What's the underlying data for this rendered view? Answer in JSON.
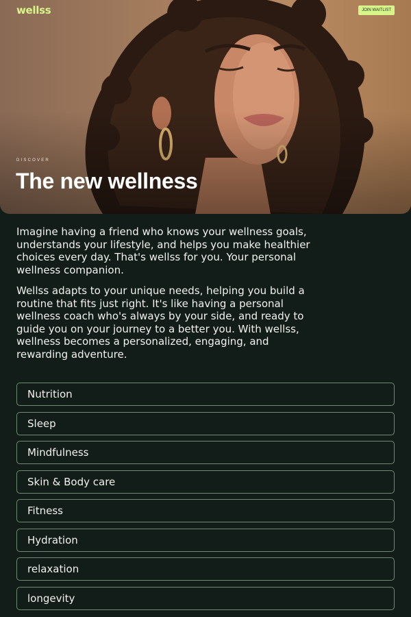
{
  "header": {
    "logo": "wellss",
    "cta_label": "JOIN WAITLIST"
  },
  "hero": {
    "eyebrow": "DISCOVER",
    "title": "The new wellness",
    "image_alt": "woman with curly hair and closed eyes"
  },
  "intro": {
    "paragraphs": [
      "Imagine having a friend who knows your wellness goals, understands your lifestyle, and helps you make healthier choices every day. That's wellss for you. Your personal wellness companion.",
      "Wellss adapts to your unique needs, helping you build a routine that fits just right. It's like having a personal wellness coach who's always by your side, and ready to guide you on your journey to a better you. With wellss, wellness becomes a personalized, engaging, and rewarding adventure."
    ]
  },
  "categories": [
    {
      "label": "Nutrition"
    },
    {
      "label": "Sleep"
    },
    {
      "label": "Mindfulness"
    },
    {
      "label": "Skin & Body care"
    },
    {
      "label": "Fitness"
    },
    {
      "label": "Hydration"
    },
    {
      "label": "relaxation"
    },
    {
      "label": "longevity"
    }
  ],
  "colors": {
    "background": "#121d19",
    "accent": "#d7f58a",
    "outline": "#6f8a75"
  }
}
